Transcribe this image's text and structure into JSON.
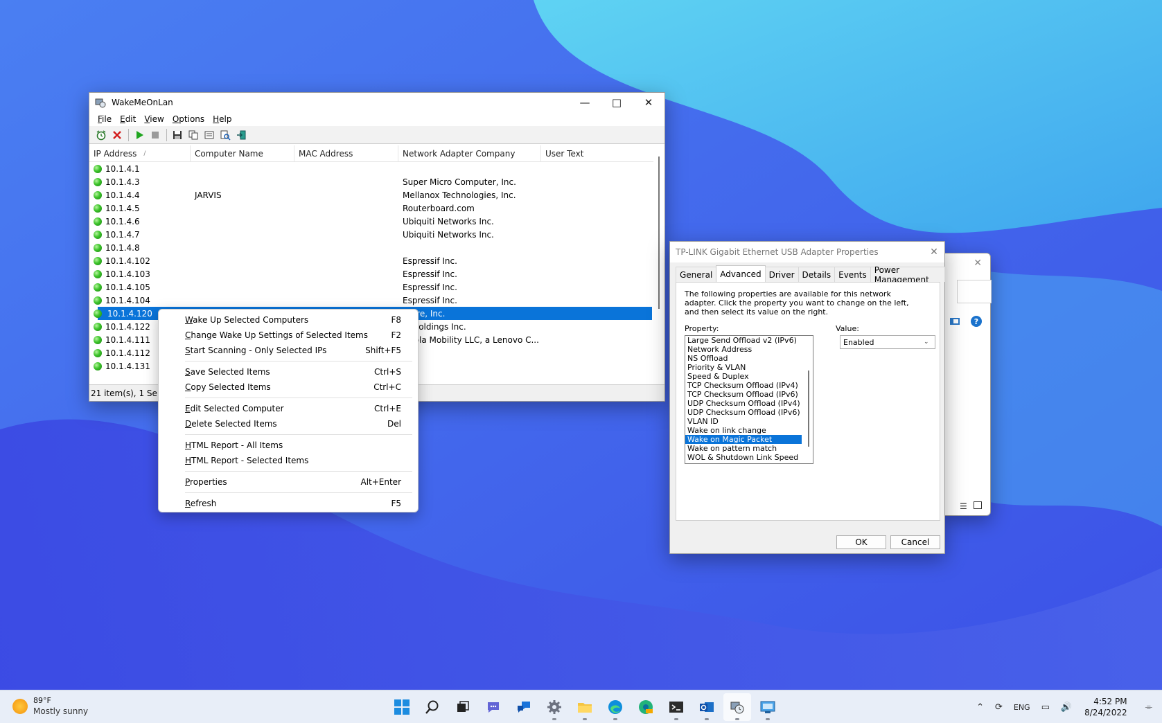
{
  "main_window": {
    "title": "WakeMeOnLan",
    "menu": [
      "File",
      "Edit",
      "View",
      "Options",
      "Help"
    ],
    "columns": [
      "IP Address",
      "Computer Name",
      "MAC Address",
      "Network Adapter Company",
      "User Text"
    ],
    "rows": [
      {
        "ip": "10.1.4.1",
        "name": "",
        "mac": "",
        "company": "",
        "user": ""
      },
      {
        "ip": "10.1.4.3",
        "name": "",
        "mac": "",
        "company": "Super Micro Computer, Inc.",
        "user": ""
      },
      {
        "ip": "10.1.4.4",
        "name": "JARVIS",
        "mac": "",
        "company": "Mellanox Technologies, Inc.",
        "user": ""
      },
      {
        "ip": "10.1.4.5",
        "name": "",
        "mac": "",
        "company": "Routerboard.com",
        "user": ""
      },
      {
        "ip": "10.1.4.6",
        "name": "",
        "mac": "",
        "company": "Ubiquiti Networks Inc.",
        "user": ""
      },
      {
        "ip": "10.1.4.7",
        "name": "",
        "mac": "",
        "company": "Ubiquiti Networks Inc.",
        "user": ""
      },
      {
        "ip": "10.1.4.8",
        "name": "",
        "mac": "",
        "company": "",
        "user": ""
      },
      {
        "ip": "10.1.4.102",
        "name": "",
        "mac": "",
        "company": "Espressif Inc.",
        "user": ""
      },
      {
        "ip": "10.1.4.103",
        "name": "",
        "mac": "",
        "company": "Espressif Inc.",
        "user": ""
      },
      {
        "ip": "10.1.4.105",
        "name": "",
        "mac": "",
        "company": "Espressif Inc.",
        "user": ""
      },
      {
        "ip": "10.1.4.104",
        "name": "",
        "mac": "",
        "company": "Espressif Inc.",
        "user": ""
      },
      {
        "ip": "10.1.4.120",
        "name": "",
        "mac": "",
        "company": "ware, Inc.",
        "user": ""
      },
      {
        "ip": "10.1.4.122",
        "name": "",
        "mac": "",
        "company": "M Holdings Inc.",
        "user": ""
      },
      {
        "ip": "10.1.4.111",
        "name": "",
        "mac": "",
        "company": "torola Mobility LLC, a Lenovo C...",
        "user": ""
      },
      {
        "ip": "10.1.4.112",
        "name": "",
        "mac": "",
        "company": "",
        "user": ""
      },
      {
        "ip": "10.1.4.131",
        "name": "",
        "mac": "",
        "company": "",
        "user": ""
      }
    ],
    "selected_row_index": 11,
    "status": "21 item(s), 1 Select"
  },
  "context_menu": {
    "groups": [
      [
        {
          "label": "Wake Up Selected Computers",
          "shortcut": "F8"
        },
        {
          "label": "Change Wake Up Settings of Selected Items",
          "shortcut": "F2"
        },
        {
          "label": "Start Scanning - Only Selected IPs",
          "shortcut": "Shift+F5"
        }
      ],
      [
        {
          "label": "Save Selected Items",
          "shortcut": "Ctrl+S"
        },
        {
          "label": "Copy Selected Items",
          "shortcut": "Ctrl+C"
        }
      ],
      [
        {
          "label": "Edit Selected Computer",
          "shortcut": "Ctrl+E"
        },
        {
          "label": "Delete Selected Items",
          "shortcut": "Del"
        }
      ],
      [
        {
          "label": "HTML Report - All Items",
          "shortcut": ""
        },
        {
          "label": "HTML Report - Selected Items",
          "shortcut": ""
        }
      ],
      [
        {
          "label": "Properties",
          "shortcut": "Alt+Enter"
        }
      ],
      [
        {
          "label": "Refresh",
          "shortcut": "F5"
        }
      ]
    ]
  },
  "properties_dialog": {
    "title": "TP-LINK Gigabit Ethernet USB Adapter Properties",
    "tabs": [
      "General",
      "Advanced",
      "Driver",
      "Details",
      "Events",
      "Power Management"
    ],
    "active_tab_index": 1,
    "description": "The following properties are available for this network adapter. Click the property you want to change on the left, and then select its value on the right.",
    "property_label": "Property:",
    "value_label": "Value:",
    "properties": [
      "Large Send Offload v2 (IPv6)",
      "Network Address",
      "NS Offload",
      "Priority & VLAN",
      "Speed & Duplex",
      "TCP Checksum Offload (IPv4)",
      "TCP Checksum Offload (IPv6)",
      "UDP Checksum Offload (IPv4)",
      "UDP Checksum Offload (IPv6)",
      "VLAN ID",
      "Wake on link change",
      "Wake on Magic Packet",
      "Wake on pattern match",
      "WOL & Shutdown Link Speed"
    ],
    "selected_property_index": 11,
    "value": "Enabled",
    "ok_label": "OK",
    "cancel_label": "Cancel"
  },
  "taskbar": {
    "weather_temp": "89°F",
    "weather_desc": "Mostly sunny",
    "language": "ENG",
    "time": "4:52 PM",
    "date": "8/24/2022"
  },
  "colors": {
    "selection": "#0a74d9",
    "wallpaper_dark": "#3a4fe0",
    "wallpaper_light": "#4fc6f0"
  }
}
